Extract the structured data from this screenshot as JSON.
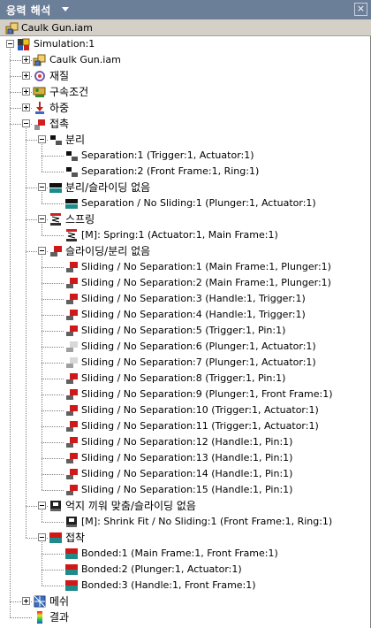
{
  "panel": {
    "title": "응력 해석",
    "close_glyph": "×"
  },
  "document": {
    "name": "Caulk Gun.iam",
    "icon": "assembly-icon"
  },
  "tree": [
    {
      "d": 0,
      "exp": "minus",
      "icon": "simulation-icon",
      "label": "Simulation:1",
      "name": "simulation-node"
    },
    {
      "d": 1,
      "exp": "plus",
      "icon": "assembly-icon",
      "label": "Caulk Gun.iam",
      "name": "assembly-node"
    },
    {
      "d": 1,
      "exp": "plus",
      "icon": "material-icon",
      "label": "재질",
      "name": "material-node"
    },
    {
      "d": 1,
      "exp": "plus",
      "icon": "constraint-icon",
      "label": "구속조건",
      "name": "constraints-node"
    },
    {
      "d": 1,
      "exp": "plus",
      "icon": "load-icon",
      "label": "하중",
      "name": "loads-node"
    },
    {
      "d": 1,
      "exp": "minus",
      "icon": "contact-icon",
      "label": "접촉",
      "name": "contacts-node"
    },
    {
      "d": 2,
      "exp": "minus",
      "icon": "separation-icon",
      "label": "분리",
      "name": "separation-group"
    },
    {
      "d": 3,
      "exp": "",
      "icon": "separation-icon",
      "label": "Separation:1 (Trigger:1, Actuator:1)",
      "name": "separation-item"
    },
    {
      "d": 3,
      "exp": "",
      "icon": "separation-icon",
      "label": "Separation:2 (Front Frame:1, Ring:1)",
      "name": "separation-item"
    },
    {
      "d": 2,
      "exp": "minus",
      "icon": "separation-nosliding-icon",
      "label": "분리/슬라이딩 없음",
      "name": "separation-nosliding-group"
    },
    {
      "d": 3,
      "exp": "",
      "icon": "separation-nosliding-icon",
      "label": "Separation / No Sliding:1 (Plunger:1, Actuator:1)",
      "name": "separation-nosliding-item"
    },
    {
      "d": 2,
      "exp": "minus",
      "icon": "spring-icon",
      "label": "스프링",
      "name": "spring-group"
    },
    {
      "d": 3,
      "exp": "",
      "icon": "spring-icon",
      "label": "[M]: Spring:1 (Actuator:1, Main Frame:1)",
      "name": "spring-item"
    },
    {
      "d": 2,
      "exp": "minus",
      "icon": "sliding-icon",
      "label": "슬라이딩/분리 없음",
      "name": "sliding-group"
    },
    {
      "d": 3,
      "exp": "",
      "icon": "sliding-icon",
      "label": "Sliding / No Separation:1 (Main Frame:1, Plunger:1)",
      "name": "sliding-item"
    },
    {
      "d": 3,
      "exp": "",
      "icon": "sliding-icon",
      "label": "Sliding / No Separation:2 (Main Frame:1, Plunger:1)",
      "name": "sliding-item"
    },
    {
      "d": 3,
      "exp": "",
      "icon": "sliding-icon",
      "label": "Sliding / No Separation:3 (Handle:1, Trigger:1)",
      "name": "sliding-item"
    },
    {
      "d": 3,
      "exp": "",
      "icon": "sliding-icon",
      "label": "Sliding / No Separation:4 (Handle:1, Trigger:1)",
      "name": "sliding-item"
    },
    {
      "d": 3,
      "exp": "",
      "icon": "sliding-icon",
      "label": "Sliding / No Separation:5 (Trigger:1, Pin:1)",
      "name": "sliding-item"
    },
    {
      "d": 3,
      "exp": "",
      "icon": "sliding-disabled-icon",
      "label": "Sliding / No Separation:6 (Plunger:1, Actuator:1)",
      "name": "sliding-item"
    },
    {
      "d": 3,
      "exp": "",
      "icon": "sliding-disabled-icon",
      "label": "Sliding / No Separation:7 (Plunger:1, Actuator:1)",
      "name": "sliding-item"
    },
    {
      "d": 3,
      "exp": "",
      "icon": "sliding-icon",
      "label": "Sliding / No Separation:8 (Trigger:1, Pin:1)",
      "name": "sliding-item"
    },
    {
      "d": 3,
      "exp": "",
      "icon": "sliding-icon",
      "label": "Sliding / No Separation:9 (Plunger:1, Front Frame:1)",
      "name": "sliding-item"
    },
    {
      "d": 3,
      "exp": "",
      "icon": "sliding-icon",
      "label": "Sliding / No Separation:10 (Trigger:1, Actuator:1)",
      "name": "sliding-item"
    },
    {
      "d": 3,
      "exp": "",
      "icon": "sliding-icon",
      "label": "Sliding / No Separation:11 (Trigger:1, Actuator:1)",
      "name": "sliding-item"
    },
    {
      "d": 3,
      "exp": "",
      "icon": "sliding-icon",
      "label": "Sliding / No Separation:12 (Handle:1, Pin:1)",
      "name": "sliding-item"
    },
    {
      "d": 3,
      "exp": "",
      "icon": "sliding-icon",
      "label": "Sliding / No Separation:13 (Handle:1, Pin:1)",
      "name": "sliding-item"
    },
    {
      "d": 3,
      "exp": "",
      "icon": "sliding-icon",
      "label": "Sliding / No Separation:14 (Handle:1, Pin:1)",
      "name": "sliding-item"
    },
    {
      "d": 3,
      "exp": "",
      "icon": "sliding-icon",
      "label": "Sliding / No Separation:15 (Handle:1, Pin:1)",
      "name": "sliding-item"
    },
    {
      "d": 2,
      "exp": "minus",
      "icon": "shrinkfit-icon",
      "label": "억지 끼워 맞춤/슬라이딩 없음",
      "name": "shrinkfit-group"
    },
    {
      "d": 3,
      "exp": "",
      "icon": "shrinkfit-icon",
      "label": "[M]: Shrink Fit / No Sliding:1 (Front Frame:1, Ring:1)",
      "name": "shrinkfit-item"
    },
    {
      "d": 2,
      "exp": "minus",
      "icon": "bonded-icon",
      "label": "접착",
      "name": "bonded-group"
    },
    {
      "d": 3,
      "exp": "",
      "icon": "bonded-icon",
      "label": "Bonded:1 (Main Frame:1, Front Frame:1)",
      "name": "bonded-item"
    },
    {
      "d": 3,
      "exp": "",
      "icon": "bonded-icon",
      "label": "Bonded:2 (Plunger:1, Actuator:1)",
      "name": "bonded-item"
    },
    {
      "d": 3,
      "exp": "",
      "icon": "bonded-icon",
      "label": "Bonded:3 (Handle:1, Front Frame:1)",
      "name": "bonded-item"
    },
    {
      "d": 1,
      "exp": "plus",
      "icon": "mesh-icon",
      "label": "메쉬",
      "name": "mesh-node"
    },
    {
      "d": 1,
      "exp": "",
      "icon": "results-icon",
      "label": "결과",
      "name": "results-node"
    }
  ]
}
